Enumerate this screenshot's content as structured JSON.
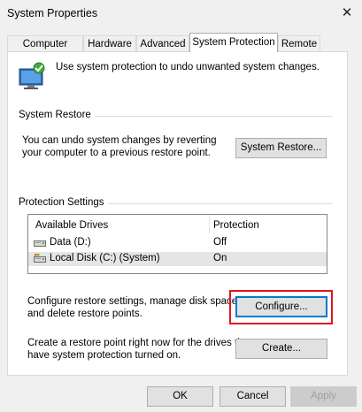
{
  "window": {
    "title": "System Properties"
  },
  "tabs": [
    {
      "label": "Computer Name"
    },
    {
      "label": "Hardware"
    },
    {
      "label": "Advanced"
    },
    {
      "label": "System Protection"
    },
    {
      "label": "Remote"
    }
  ],
  "active_tab": "System Protection",
  "intro": {
    "text": "Use system protection to undo unwanted system changes."
  },
  "system_restore": {
    "group_label": "System Restore",
    "description_line1": "You can undo system changes by reverting",
    "description_line2": "your computer to a previous restore point.",
    "button_label": "System Restore..."
  },
  "protection_settings": {
    "group_label": "Protection Settings",
    "columns": [
      "Available Drives",
      "Protection"
    ],
    "drives": [
      {
        "name": "Data (D:)",
        "protection": "Off",
        "icon": "drive-icon"
      },
      {
        "name": "Local Disk (C:) (System)",
        "protection": "On",
        "icon": "system-drive-icon",
        "selected": true
      }
    ],
    "configure_text_line1": "Configure restore settings, manage disk space,",
    "configure_text_line2": "and delete restore points.",
    "configure_button": "Configure...",
    "create_text_line1": "Create a restore point right now for the drives that",
    "create_text_line2": "have system protection turned on.",
    "create_button": "Create..."
  },
  "footer": {
    "ok": "OK",
    "cancel": "Cancel",
    "apply": "Apply"
  },
  "colors": {
    "highlight": "#e0141e",
    "focus": "#0078d7"
  }
}
